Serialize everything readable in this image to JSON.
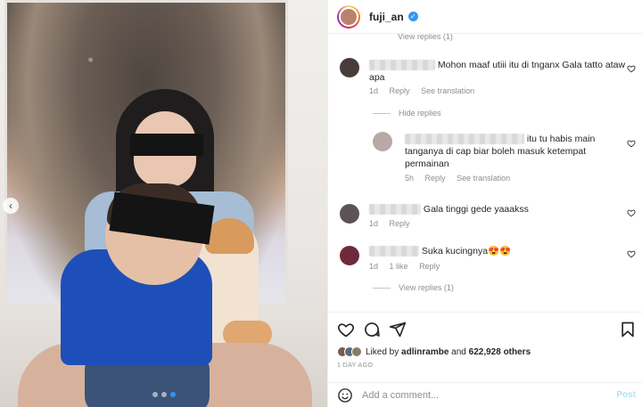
{
  "header": {
    "username": "fuji_an",
    "verified_icon": "verified-badge-icon"
  },
  "comments": {
    "view_replies_top": "View replies (1)",
    "items": [
      {
        "text": "Mohon maaf utiii itu di tnganx Gala tatto ataw apa",
        "time": "1d",
        "reply": "Reply",
        "translation": "See translation"
      },
      {
        "text": "itu tu habis main tanganya di cap biar boleh masuk ketempat permainan",
        "time": "5h",
        "reply": "Reply",
        "translation": "See translation"
      },
      {
        "text": "Gala tinggi gede yaaakss",
        "time": "1d",
        "reply": "Reply"
      },
      {
        "text": "Suka kucingnya😍😍",
        "time": "1d",
        "likes": "1 like",
        "reply": "Reply"
      }
    ],
    "hide_replies": "Hide replies",
    "view_replies_bottom": "View replies (1)"
  },
  "likes": {
    "prefix": "Liked by",
    "user": "adlinrambe",
    "and": "and",
    "count": "622,928 others"
  },
  "time_ago": "1 DAY AGO",
  "add_comment": {
    "placeholder": "Add a comment...",
    "post": "Post"
  },
  "colors": {
    "accent": "#3797f0",
    "post_disabled": "#b2dffc",
    "meta": "#8e8e8e"
  }
}
